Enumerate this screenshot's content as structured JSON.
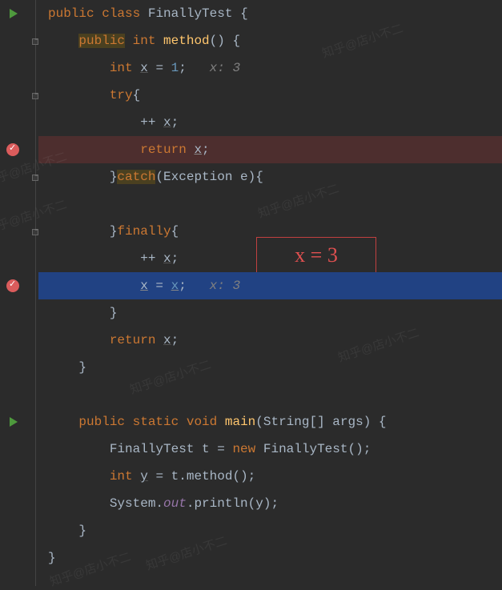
{
  "code": {
    "line1": {
      "kw_public": "public",
      "kw_class": "class",
      "classname": "FinallyTest",
      "brace": " {"
    },
    "line2": {
      "kw_public": "public",
      "kw_int": "int",
      "method": "method",
      "rest": "() {"
    },
    "line3": {
      "kw_int": "int",
      "var": "x",
      "eq": " = ",
      "val": "1",
      "semi": ";",
      "hint": "   x: 3"
    },
    "line4": {
      "kw_try": "try",
      "brace": "{"
    },
    "line5": {
      "op": "++ ",
      "var": "x",
      "semi": ";"
    },
    "line6": {
      "kw_return": "return",
      "var": "x",
      "semi": ";"
    },
    "line7": {
      "brace": "}",
      "kw_catch": "catch",
      "rest": "(Exception e){"
    },
    "line8": {
      "blank": ""
    },
    "line9": {
      "brace": "}",
      "kw_finally": "finally",
      "brace2": "{"
    },
    "line10": {
      "op": "++ ",
      "var": "x",
      "semi": ";"
    },
    "line11": {
      "var1": "x",
      "eq": " = ",
      "var2": "x",
      "semi": ";",
      "hint": "   x: 3"
    },
    "line12": {
      "brace": "}"
    },
    "line13": {
      "kw_return": "return",
      "var": "x",
      "semi": ";"
    },
    "line14": {
      "brace": "}"
    },
    "line15": {
      "blank": ""
    },
    "line16": {
      "kw_public": "public",
      "kw_static": "static",
      "kw_void": "void",
      "method": "main",
      "rest": "(String[] args) {"
    },
    "line17": {
      "cls": "FinallyTest",
      "var": " t",
      "eq": " = ",
      "kw_new": "new",
      "ctor": " FinallyTest",
      "rest": "();"
    },
    "line18": {
      "kw_int": "int",
      "var": "y",
      "eq": " = ",
      "rest": "t.method();"
    },
    "line19": {
      "sys": "System.",
      "out": "out",
      "rest": ".println(y);"
    },
    "line20": {
      "brace": "}"
    },
    "line21": {
      "brace": "}"
    }
  },
  "annotation": "x = 3",
  "watermark": "知乎@店小不二"
}
